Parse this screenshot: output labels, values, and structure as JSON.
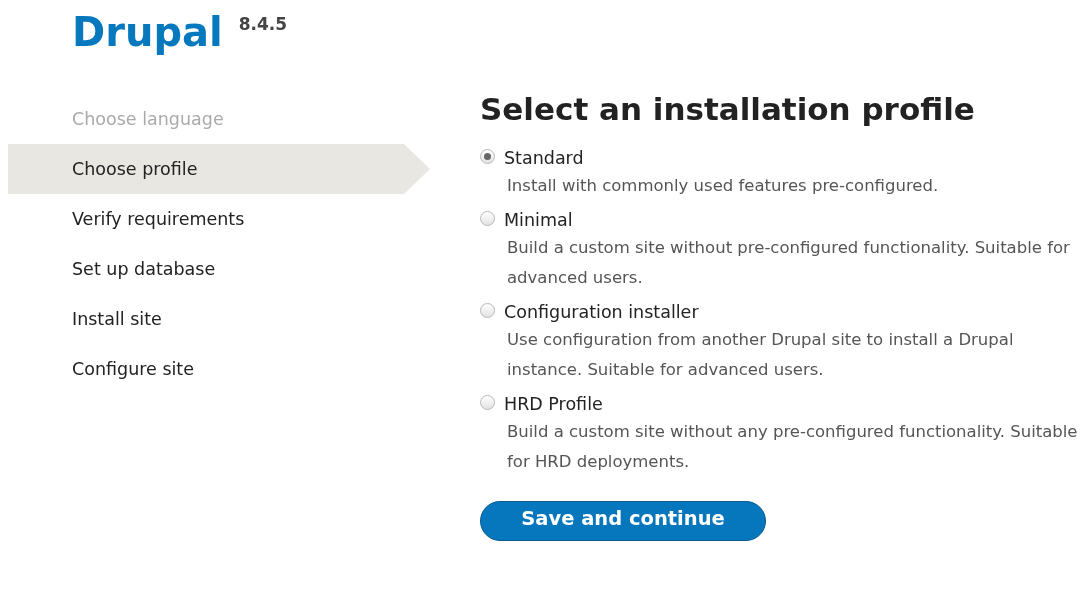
{
  "logo": {
    "name": "Drupal",
    "version": "8.4.5"
  },
  "steps": [
    {
      "label": "Choose language",
      "done": true,
      "selected": false
    },
    {
      "label": "Choose profile",
      "done": false,
      "selected": true
    },
    {
      "label": "Verify requirements",
      "done": false,
      "selected": false
    },
    {
      "label": "Set up database",
      "done": false,
      "selected": false
    },
    {
      "label": "Install site",
      "done": false,
      "selected": false
    },
    {
      "label": "Configure site",
      "done": false,
      "selected": false
    }
  ],
  "heading": "Select an installation profile",
  "profiles": [
    {
      "label": "Standard",
      "selected": true,
      "description": "Install with commonly used features pre-configured."
    },
    {
      "label": "Minimal",
      "selected": false,
      "description": "Build a custom site without pre-configured functionality. Suitable for advanced users."
    },
    {
      "label": "Configuration installer",
      "selected": false,
      "description": "Use configuration from another Drupal site to install a Drupal instance. Suitable for advanced users."
    },
    {
      "label": "HRD Profile",
      "selected": false,
      "description": "Build a custom site without any pre-configured functionality. Suitable for HRD deployments."
    }
  ],
  "button": "Save and continue"
}
